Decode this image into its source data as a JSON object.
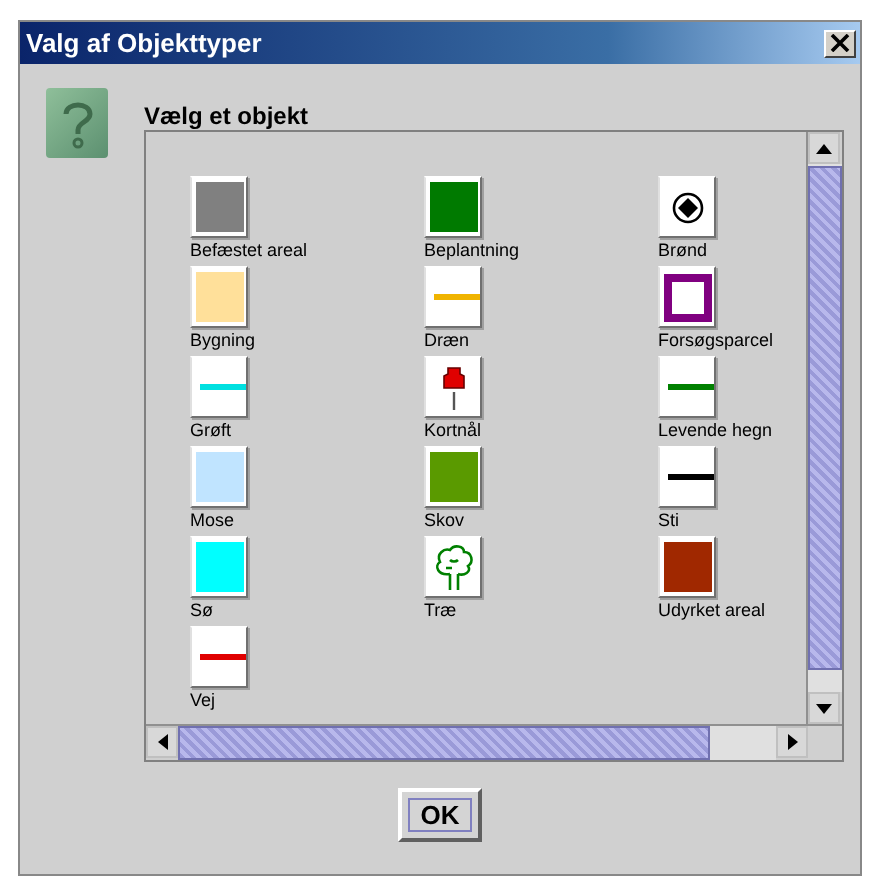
{
  "window": {
    "title": "Valg af Objekttyper"
  },
  "heading": "Vælg et objekt",
  "items": [
    {
      "label": "Befæstet areal",
      "kind": "swatch",
      "color": "#808080"
    },
    {
      "label": "Beplantning",
      "kind": "swatch",
      "color": "#007a00"
    },
    {
      "label": "Brønd",
      "kind": "well"
    },
    {
      "label": "Bygning",
      "kind": "swatch",
      "color": "#ffe09a"
    },
    {
      "label": "Dræn",
      "kind": "line",
      "color": "#f0b400"
    },
    {
      "label": "Forsøgsparcel",
      "kind": "parcel",
      "color": "#800080"
    },
    {
      "label": "Grøft",
      "kind": "line",
      "color": "#00e0e0"
    },
    {
      "label": "Kortnål",
      "kind": "pin",
      "color": "#e00000"
    },
    {
      "label": "Levende hegn",
      "kind": "line",
      "color": "#008000"
    },
    {
      "label": "Mose",
      "kind": "swatch",
      "color": "#c0e4ff"
    },
    {
      "label": "Skov",
      "kind": "swatch",
      "color": "#5a9a00"
    },
    {
      "label": "Sti",
      "kind": "line",
      "color": "#000000"
    },
    {
      "label": "Sø",
      "kind": "swatch",
      "color": "#00ffff"
    },
    {
      "label": "Træ",
      "kind": "tree",
      "color": "#008000"
    },
    {
      "label": "Udyrket areal",
      "kind": "swatch",
      "color": "#a02800"
    },
    {
      "label": "Vej",
      "kind": "line",
      "color": "#e00000"
    }
  ],
  "button": "OK"
}
